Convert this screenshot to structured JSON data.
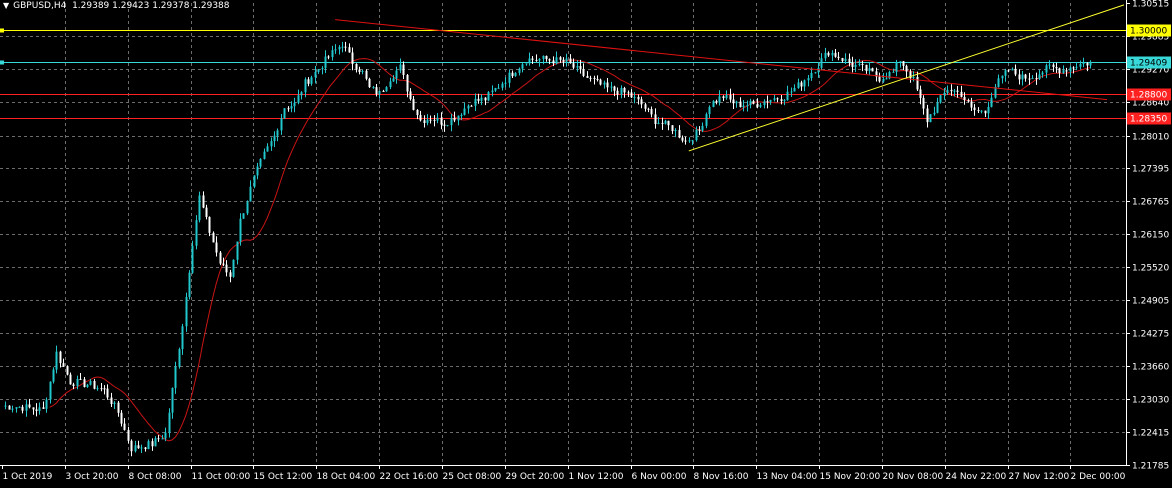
{
  "header": {
    "symbol": "GBPUSD,H4",
    "ohlc": "1.29389 1.29423 1.29378 1.29388"
  },
  "colors": {
    "background": "#000000",
    "grid": "#6c6c6c",
    "bull": "#22c7cd",
    "bear": "#ffffff",
    "ma": "#c81414",
    "support_resistance": "#ff2020",
    "trendline_red": "#e01010",
    "trendline_yellow": "#ffff30",
    "level_yellow": "#ffff00",
    "level_cyan": "#38d8d8"
  },
  "chart_data": {
    "type": "candlestick",
    "ylim": [
      1.21785,
      1.30515
    ],
    "price_ticks": [
      "1.30515",
      "1.29885",
      "1.29270",
      "1.28640",
      "1.28010",
      "1.27395",
      "1.26765",
      "1.26150",
      "1.25520",
      "1.24905",
      "1.24275",
      "1.23660",
      "1.23030",
      "1.22415",
      "1.21785"
    ],
    "time_ticks": [
      "1 Oct 2019",
      "3 Oct 20:00",
      "8 Oct 08:00",
      "11 Oct 00:00",
      "15 Oct 12:00",
      "18 Oct 04:00",
      "22 Oct 16:00",
      "25 Oct 08:00",
      "29 Oct 20:00",
      "1 Nov 12:00",
      "6 Nov 00:00",
      "8 Nov 16:00",
      "13 Nov 04:00",
      "15 Nov 20:00",
      "20 Nov 08:00",
      "24 Nov 22:00",
      "27 Nov 12:00",
      "2 Dec 00:00"
    ],
    "levels": [
      {
        "price": 1.3,
        "label": "1.30000",
        "color": "yellow"
      },
      {
        "price": 1.29409,
        "label": "1.29409",
        "color": "cyan"
      },
      {
        "price": 1.288,
        "label": "1.28800",
        "color": "red"
      },
      {
        "price": 1.2835,
        "label": "1.28350",
        "color": "red"
      }
    ],
    "trendlines": [
      {
        "color": "red",
        "from": {
          "bar": 98,
          "price": 1.302
        },
        "to": {
          "bar": 325,
          "price": 1.2869
        }
      },
      {
        "color": "yellow",
        "from": {
          "bar": 202,
          "price": 1.2772
        },
        "to": {
          "bar": 330,
          "price": 1.3048
        }
      }
    ],
    "anchors": [
      [
        0,
        1.229
      ],
      [
        6,
        1.2288
      ],
      [
        12,
        1.2282
      ],
      [
        16,
        1.239
      ],
      [
        20,
        1.2336
      ],
      [
        26,
        1.233
      ],
      [
        30,
        1.232
      ],
      [
        34,
        1.2278
      ],
      [
        38,
        1.221
      ],
      [
        44,
        1.2218
      ],
      [
        48,
        1.2238
      ],
      [
        50,
        1.232
      ],
      [
        53,
        1.2445
      ],
      [
        56,
        1.26
      ],
      [
        58,
        1.2685
      ],
      [
        60,
        1.264
      ],
      [
        64,
        1.256
      ],
      [
        67,
        1.2535
      ],
      [
        70,
        1.264
      ],
      [
        74,
        1.272
      ],
      [
        77,
        1.2765
      ],
      [
        80,
        1.28
      ],
      [
        83,
        1.2855
      ],
      [
        86,
        1.286
      ],
      [
        89,
        1.29
      ],
      [
        92,
        1.292
      ],
      [
        96,
        1.295
      ],
      [
        100,
        1.2975
      ],
      [
        103,
        1.294
      ],
      [
        106,
        1.292
      ],
      [
        108,
        1.289
      ],
      [
        111,
        1.288
      ],
      [
        114,
        1.291
      ],
      [
        117,
        1.293
      ],
      [
        120,
        1.287
      ],
      [
        123,
        1.283
      ],
      [
        126,
        1.2835
      ],
      [
        130,
        1.2825
      ],
      [
        134,
        1.284
      ],
      [
        138,
        1.2865
      ],
      [
        142,
        1.287
      ],
      [
        146,
        1.2895
      ],
      [
        150,
        1.292
      ],
      [
        154,
        1.2945
      ],
      [
        160,
        1.2945
      ],
      [
        166,
        1.294
      ],
      [
        172,
        1.291
      ],
      [
        178,
        1.289
      ],
      [
        184,
        1.288
      ],
      [
        188,
        1.286
      ],
      [
        192,
        1.283
      ],
      [
        197,
        1.2815
      ],
      [
        201,
        1.279
      ],
      [
        205,
        1.281
      ],
      [
        208,
        1.286
      ],
      [
        212,
        1.2875
      ],
      [
        216,
        1.286
      ],
      [
        221,
        1.286
      ],
      [
        226,
        1.287
      ],
      [
        230,
        1.2875
      ],
      [
        235,
        1.29
      ],
      [
        240,
        1.2935
      ],
      [
        243,
        1.296
      ],
      [
        246,
        1.295
      ],
      [
        250,
        1.2935
      ],
      [
        254,
        1.2925
      ],
      [
        258,
        1.291
      ],
      [
        262,
        1.292
      ],
      [
        264,
        1.2945
      ],
      [
        268,
        1.2905
      ],
      [
        272,
        1.283
      ],
      [
        275,
        1.286
      ],
      [
        278,
        1.289
      ],
      [
        282,
        1.288
      ],
      [
        285,
        1.285
      ],
      [
        289,
        1.2845
      ],
      [
        292,
        1.2895
      ],
      [
        296,
        1.2925
      ],
      [
        300,
        1.291
      ],
      [
        304,
        1.2915
      ],
      [
        308,
        1.293
      ],
      [
        312,
        1.2925
      ],
      [
        316,
        1.2935
      ],
      [
        320,
        1.2939
      ]
    ]
  }
}
